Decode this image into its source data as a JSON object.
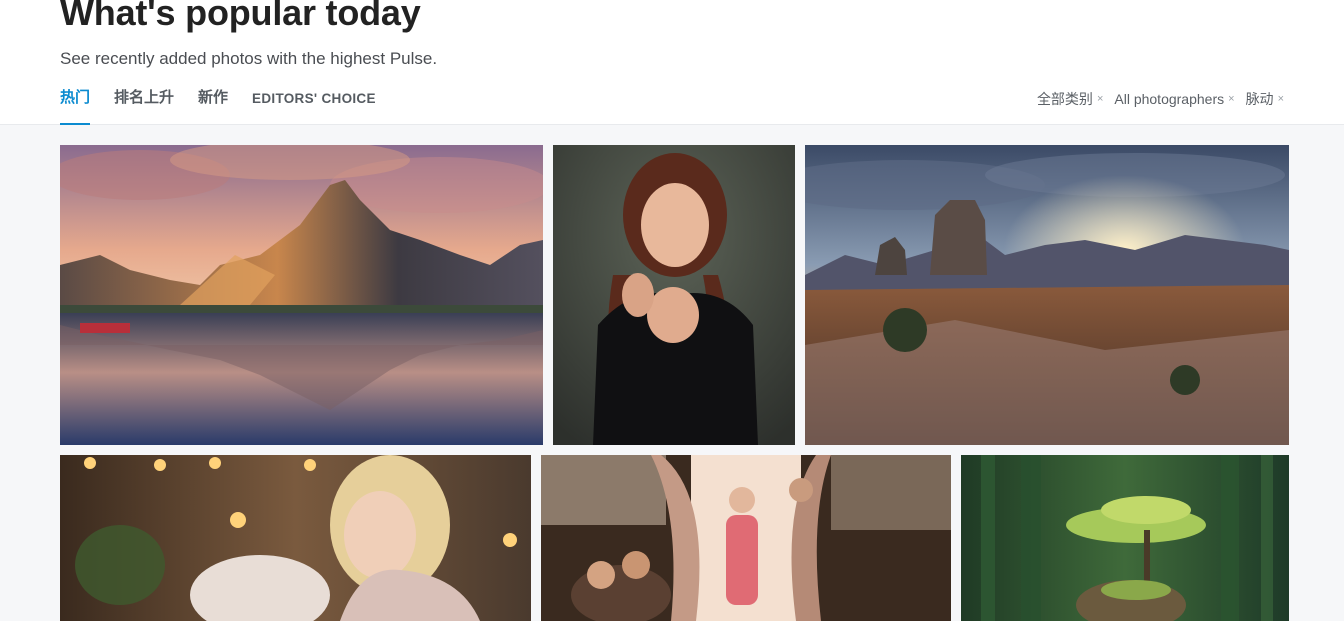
{
  "page": {
    "title": "What's popular today",
    "subtitle": "See recently added photos with the highest Pulse."
  },
  "tabs": [
    {
      "label": "热门",
      "active": true
    },
    {
      "label": "排名上升",
      "active": false
    },
    {
      "label": "新作",
      "active": false
    },
    {
      "label": "EDITORS' CHOICE",
      "active": false
    }
  ],
  "filters": [
    {
      "label": "全部类别",
      "clear_icon": "×"
    },
    {
      "label": "All photographers",
      "clear_icon": "×"
    },
    {
      "label": "脉动",
      "clear_icon": "×"
    }
  ],
  "photos": [
    {
      "subject": "mountain-lake-reflection"
    },
    {
      "subject": "woman-portrait-braids"
    },
    {
      "subject": "sunset-rock-landscape"
    },
    {
      "subject": "blonde-woman-bokeh-lights"
    },
    {
      "subject": "family-window-scene"
    },
    {
      "subject": "tree-on-rock-green"
    }
  ],
  "colors": {
    "accent": "#0b8bd0",
    "background": "#f6f7f9",
    "header": "#ffffff"
  }
}
